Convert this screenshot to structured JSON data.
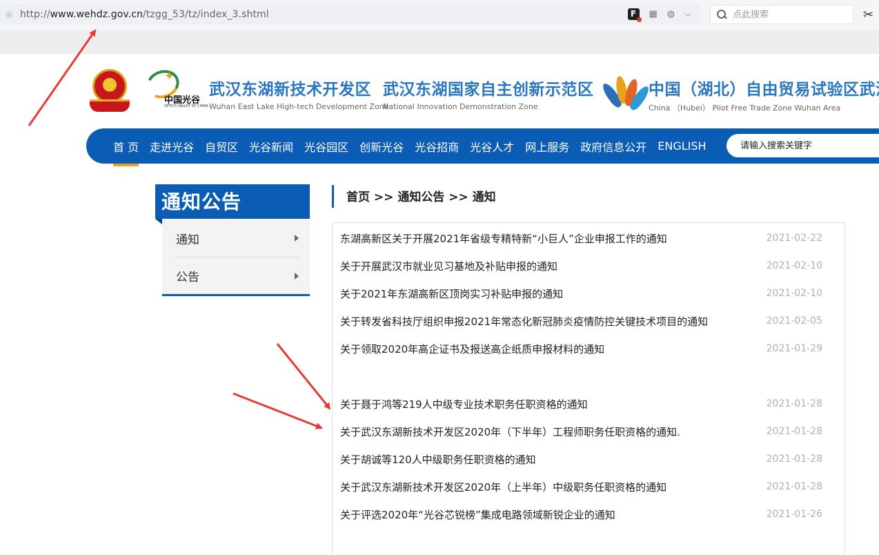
{
  "browser": {
    "url_prefix": "http://",
    "url_domain": "www.wehdz.gov.cn",
    "url_path": "/tzgg_53/tz/index_3.shtml",
    "search_placeholder": "点此搜索",
    "f_icon_label": "F"
  },
  "header": {
    "ovc_cn": "中国光谷",
    "ovc_en": "OPTICS VALLEY OF CHINA",
    "zones": [
      {
        "cn": "武汉东湖新技术开发区",
        "en": "Wuhan East Lake High-tech Development Zone"
      },
      {
        "cn": "武汉东湖国家自主创新示范区",
        "en": "National Innovation Demonstration Zone"
      },
      {
        "cn": "中国（湖北）自由贸易试验区武汉片区",
        "en": "China （Hubei） Pilot Free Trade Zone Wuhan Area"
      }
    ]
  },
  "nav": {
    "items": [
      "首 页",
      "走进光谷",
      "自贸区",
      "光谷新闻",
      "光谷园区",
      "创新光谷",
      "光谷招商",
      "光谷人才",
      "网上服务",
      "政府信息公开",
      "ENGLISH"
    ],
    "search_placeholder": "请输入搜索关键字"
  },
  "sidebar": {
    "title": "通知公告",
    "items": [
      "通知",
      "公告"
    ]
  },
  "breadcrumb": "首页 >> 通知公告 >> 通知",
  "notices": [
    {
      "title": "东湖高新区关于开展2021年省级专精特新“小巨人”企业申报工作的通知",
      "date": "2021-02-22"
    },
    {
      "title": "关于开展武汉市就业见习基地及补贴申报的通知",
      "date": "2021-02-10"
    },
    {
      "title": "关于2021年东湖高新区顶岗实习补贴申报的通知",
      "date": "2021-02-10"
    },
    {
      "title": "关于转发省科技厅组织申报2021年常态化新冠肺炎疫情防控关键技术项目的通知",
      "date": "2021-02-05"
    },
    {
      "title": "关于领取2020年高企证书及报送高企纸质申报材料的通知",
      "date": "2021-01-29"
    },
    {
      "title": "关于聂于鸿等219人中级专业技术职务任职资格的通知",
      "date": "2021-01-28"
    },
    {
      "title": "关于武汉东湖新技术开发区2020年（下半年）工程师职务任职资格的通知.",
      "date": "2021-01-28"
    },
    {
      "title": "关于胡诚等120人中级职务任职资格的通知",
      "date": "2021-01-28"
    },
    {
      "title": "关于武汉东湖新技术开发区2020年（上半年）中级职务任职资格的通知",
      "date": "2021-01-28"
    },
    {
      "title": "关于评选2020年“光谷芯锐榜”集成电路领域新锐企业的通知",
      "date": "2021-01-26"
    }
  ],
  "colors": {
    "brand_blue": "#0a5cb5",
    "accent_orange": "#f0a020",
    "annotation_red": "#e53b32"
  }
}
